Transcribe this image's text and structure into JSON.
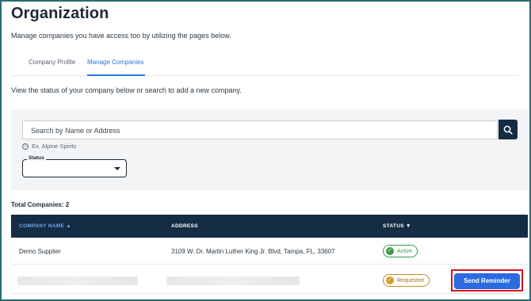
{
  "header": {
    "title": "Organization",
    "description": "Manage companies you have access too by utilizing the pages below."
  },
  "tabs": [
    {
      "label": "Company Profile",
      "active": false
    },
    {
      "label": "Manage Companies",
      "active": true
    }
  ],
  "section": {
    "description": "View the status of your company below or search to add a new company."
  },
  "filters": {
    "search_placeholder": "Search by Name or Address",
    "search_hint": "Ex. Alpine Spirits",
    "status_label": "Status",
    "status_value": ""
  },
  "summary": {
    "total_label": "Total Companies: 2"
  },
  "table": {
    "columns": [
      "COMPANY NAME",
      "ADDRESS",
      "STATUS"
    ],
    "sort_icon": "caret-up-icon",
    "rows": [
      {
        "name": "Demo Supplier",
        "address": "3109 W. Dr. Martin Luther King Jr. Blvd, Tampa, FL, 33607",
        "status": "Active"
      },
      {
        "name": "",
        "address": "",
        "status": "Requested",
        "action": "Send Reminder"
      }
    ]
  },
  "colors": {
    "header_bg": "#142c44",
    "accent": "#2c74d6",
    "active": "#3e9a4d",
    "requested": "#c58a21",
    "highlight_border": "#d6141c",
    "button": "#2a6be0"
  },
  "icons": [
    "search-icon",
    "info-icon",
    "chevron-down-icon",
    "caret-up-icon",
    "caret-down-icon",
    "check-circle-icon",
    "clock-check-icon"
  ]
}
